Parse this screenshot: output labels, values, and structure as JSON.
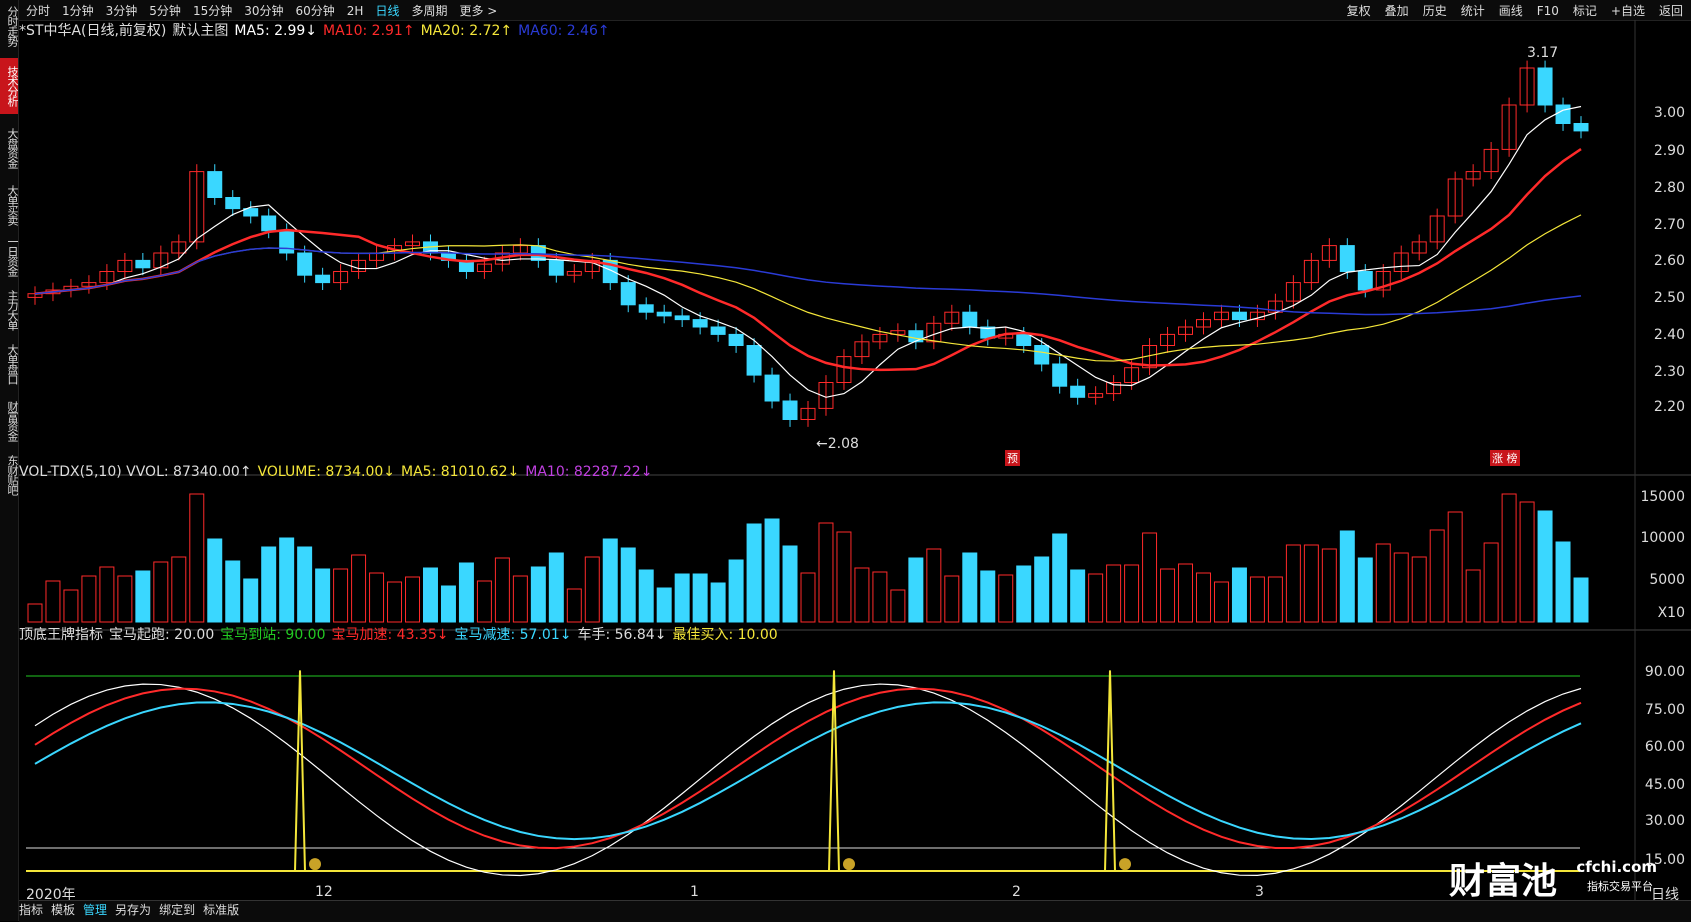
{
  "toolbar": {
    "periods": [
      "分时",
      "1分钟",
      "3分钟",
      "5分钟",
      "15分钟",
      "30分钟",
      "60分钟",
      "2H",
      "日线",
      "多周期",
      "更多 >"
    ],
    "active_period": "日线",
    "right_menu": [
      "复权",
      "叠加",
      "历史",
      "统计",
      "画线",
      "F10",
      "标记",
      "+自选",
      "返回"
    ]
  },
  "rail": [
    "分时走势",
    "技术分析",
    "大盘资金",
    "大单买卖",
    "一日资金",
    "主力大单",
    "大单盘口",
    "财富资金",
    "东财贴吧"
  ],
  "rail_active": "技术分析",
  "main": {
    "legend": [
      {
        "text": "*ST中华A(日线,前复权)",
        "color": "#dddddd"
      },
      {
        "text": "默认主图",
        "color": "#dddddd"
      },
      {
        "text": "MA5: 2.99↓",
        "color": "#ffffff"
      },
      {
        "text": "MA10: 2.91↑",
        "color": "#ff2a2a"
      },
      {
        "text": "MA20: 2.72↑",
        "color": "#f4e63a"
      },
      {
        "text": "MA60: 2.46↑",
        "color": "#2a3bd6"
      }
    ],
    "price_axis": [
      "3.00",
      "2.90",
      "2.80",
      "2.70",
      "2.60",
      "2.50",
      "2.40",
      "2.30",
      "2.20"
    ],
    "high_label": "3.17",
    "low_label": "←2.08",
    "marker_left": "预",
    "marker_right": "涨 榜"
  },
  "volume": {
    "legend": [
      {
        "text": "VOL-TDX(5,10) VVOL: 87340.00↑",
        "color": "#dddddd"
      },
      {
        "text": "VOLUME: 8734.00↓",
        "color": "#f4e63a"
      },
      {
        "text": "MA5: 81010.62↓",
        "color": "#f4e63a"
      },
      {
        "text": "MA10: 82287.22↓",
        "color": "#c040e0"
      }
    ],
    "axis": [
      "15000",
      "10000",
      "5000",
      "X10"
    ]
  },
  "indicator": {
    "legend": [
      {
        "text": "顶底王牌指标",
        "color": "#dddddd"
      },
      {
        "text": "宝马起跑: 20.00",
        "color": "#dddddd"
      },
      {
        "text": "宝马到站: 90.00",
        "color": "#22c922"
      },
      {
        "text": "宝马加速: 43.35↓",
        "color": "#ff2a2a"
      },
      {
        "text": "宝马减速: 57.01↓",
        "color": "#3ad7ff"
      },
      {
        "text": "车手: 56.84↓",
        "color": "#dddddd"
      },
      {
        "text": "最佳买入: 10.00",
        "color": "#f4e63a"
      }
    ],
    "axis": [
      "90.00",
      "75.00",
      "60.00",
      "45.00",
      "30.00",
      "15.00"
    ]
  },
  "x_labels": [
    "2020年",
    "12",
    "1",
    "2",
    "3"
  ],
  "bottom_bar": [
    "指标",
    "模板",
    "管理",
    "另存为",
    "绑定到",
    "标准版"
  ],
  "bottom_active": "管理",
  "corner_label": "日线",
  "watermark": {
    "brand": "财富池",
    "url": "cfchi.com",
    "tagline": "指标交易平台"
  },
  "colors": {
    "up": "#ff2a2a",
    "down": "#3ad7ff",
    "ma5": "#ffffff",
    "ma10": "#ff2a2a",
    "ma20": "#f4e63a",
    "ma60": "#2a3bd6"
  }
}
